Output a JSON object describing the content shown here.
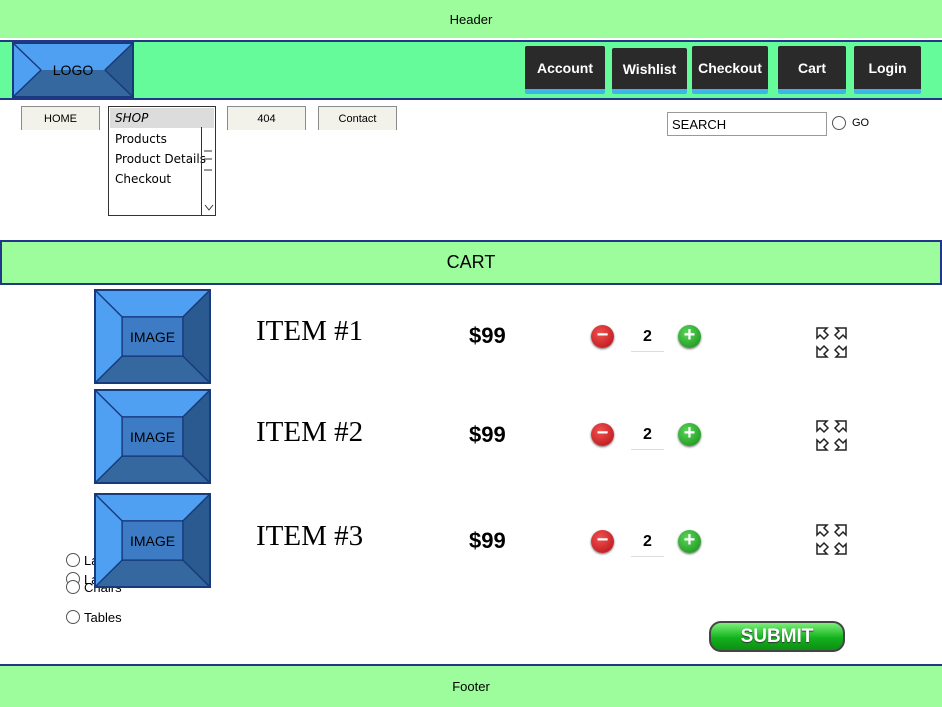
{
  "header": {
    "label": "Header"
  },
  "footer": {
    "label": "Footer"
  },
  "navbar": {
    "logo": "LOGO",
    "buttons": [
      "Account",
      "Wishlist",
      "Checkout",
      "Cart",
      "Login"
    ]
  },
  "tabs": {
    "home": "HOME",
    "shop": "SHOP",
    "p404": "404",
    "contact": "Contact"
  },
  "dropdown": {
    "selected": "SHOP",
    "items": [
      "Products",
      "Product Details",
      "Checkout"
    ]
  },
  "search": {
    "value": "SEARCH",
    "go_label": "GO"
  },
  "cart": {
    "title": "CART",
    "items": [
      {
        "image": "IMAGE",
        "name": "ITEM #1",
        "price": "$99",
        "qty": "2"
      },
      {
        "image": "IMAGE",
        "name": "ITEM #2",
        "price": "$99",
        "qty": "2"
      },
      {
        "image": "IMAGE",
        "name": "ITEM #3",
        "price": "$99",
        "qty": "2"
      }
    ],
    "submit_label": "SUBMIT"
  },
  "filters": [
    "La",
    "La",
    "Chairs",
    "Tables"
  ],
  "colors": {
    "band": "#9dfc9b",
    "navbar": "#66fb9a",
    "border": "#23378a",
    "navbtn": "#2a2a2a",
    "accent": "#3ab6e8"
  }
}
